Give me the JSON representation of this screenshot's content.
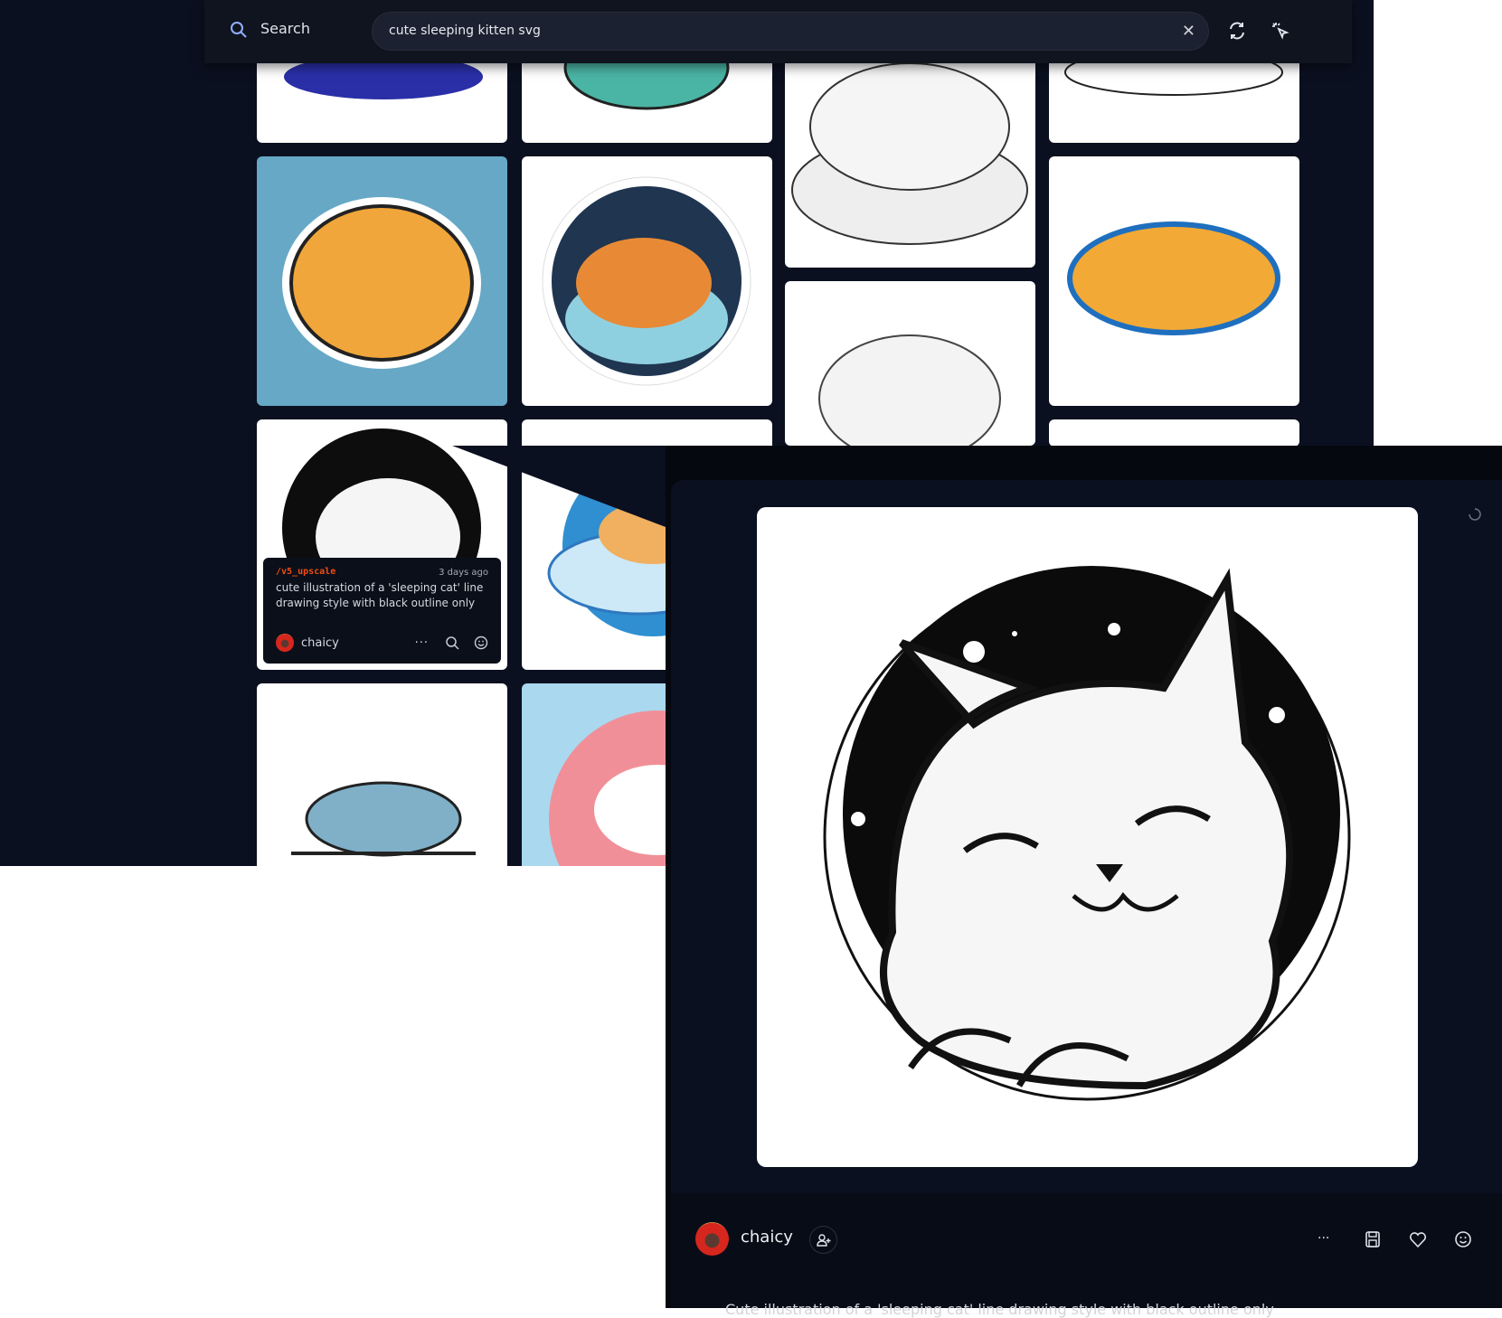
{
  "header": {
    "search_label": "Search",
    "query": "cute sleeping kitten svg",
    "clear_icon": "close-icon",
    "refresh_icon": "refresh-icon",
    "cursor_icon": "cursor-click-icon"
  },
  "hover_card": {
    "command": "/v5_upscale",
    "time": "3 days ago",
    "prompt": "cute illustration of a 'sleeping cat' line drawing style with black outline only",
    "user": "chaicy"
  },
  "detail": {
    "user": "chaicy",
    "description": "Cute illustration of a 'sleeping cat' line drawing style with black outline only",
    "actions": [
      "more-icon",
      "save-icon",
      "heart-icon",
      "emoji-icon"
    ]
  },
  "colors": {
    "accent": "#f24d12",
    "background": "#0b1020",
    "panel": "#080c17"
  }
}
